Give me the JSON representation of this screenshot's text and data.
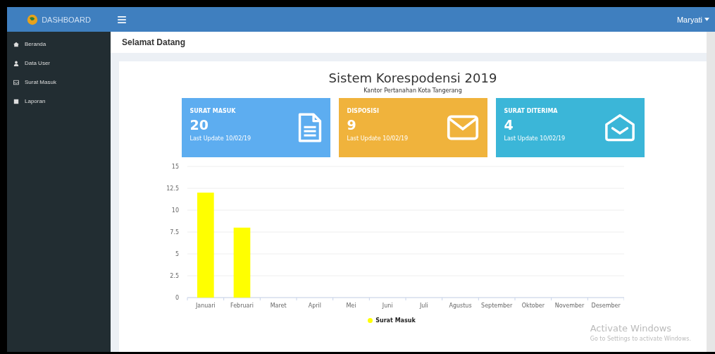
{
  "brand": "DASHBOARD",
  "user": {
    "name": "Maryati"
  },
  "sidebar": {
    "items": [
      {
        "label": "Beranda",
        "kind": "home"
      },
      {
        "label": "Data User",
        "kind": "user"
      },
      {
        "label": "Surat Masuk",
        "kind": "inbox"
      },
      {
        "label": "Laporan",
        "kind": "report"
      }
    ]
  },
  "page_title": "Selamat Datang",
  "heading": "Sistem Korespodensi 2019",
  "subheading": "Kantor Pertanahan Kota Tangerang",
  "cards": [
    {
      "title": "SURAT MASUK",
      "count": "20",
      "update": "Last Update 10/02/19",
      "kind": "document",
      "color": "#5dadf0"
    },
    {
      "title": "DISPOSISI",
      "count": "9",
      "update": "Last Update 10/02/19",
      "kind": "envelope",
      "color": "#f0b33c"
    },
    {
      "title": "SURAT DITERIMA",
      "count": "4",
      "update": "Last Update 10/02/19",
      "kind": "open",
      "color": "#3bb6d8"
    }
  ],
  "chart": {
    "chart_data": {
      "type": "bar",
      "categories": [
        "Januari",
        "Februari",
        "Maret",
        "April",
        "Mei",
        "Juni",
        "Juli",
        "Agustus",
        "September",
        "Oktober",
        "November",
        "Desember"
      ],
      "series": [
        {
          "name": "Surat Masuk",
          "color": "#ffff00",
          "values": [
            12,
            8,
            0,
            0,
            0,
            0,
            0,
            0,
            0,
            0,
            0,
            0
          ]
        }
      ],
      "ylim": [
        0,
        15
      ],
      "grid": true,
      "yticks": [
        0,
        {
          "value": 2.5,
          "label": "2.5"
        },
        5,
        {
          "value": 7.5,
          "label": "7.5"
        },
        10,
        {
          "value": 12.5,
          "label": "12.5"
        },
        15
      ]
    }
  },
  "os_notice": {
    "title": "Activate Windows",
    "text": "Go to Settings to activate Windows."
  }
}
